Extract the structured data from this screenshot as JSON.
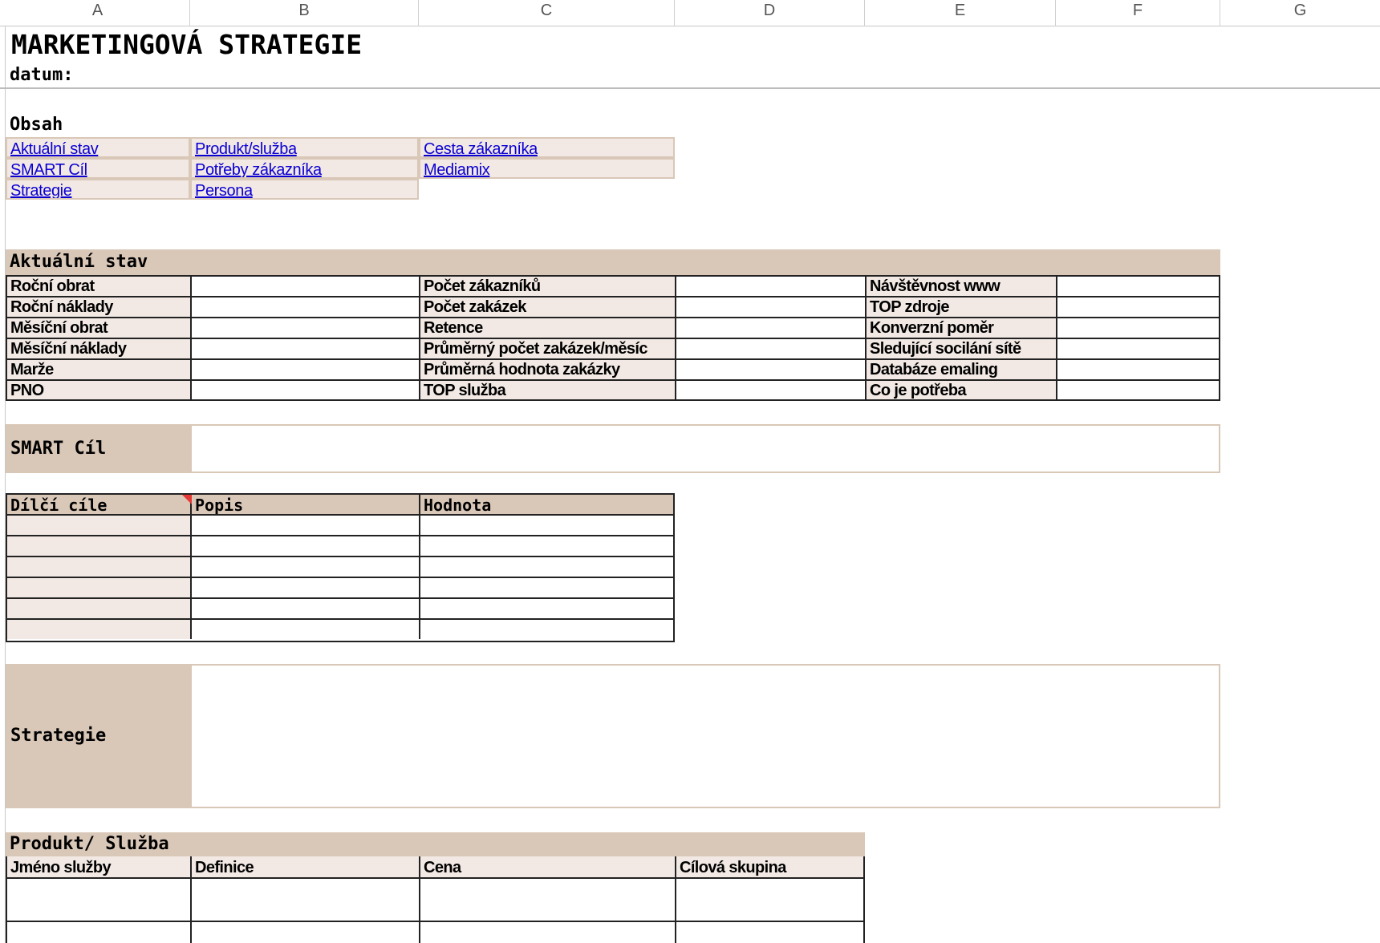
{
  "columns": [
    "A",
    "B",
    "C",
    "D",
    "E",
    "F",
    "G"
  ],
  "title": "MARKETINGOVÁ STRATEGIE",
  "date_label": "datum:",
  "toc": {
    "heading": "Obsah",
    "links": [
      "Aktuální stav",
      "Produkt/služba",
      "Cesta zákazníka",
      "SMART Cíl",
      "Potřeby zákazníka",
      "Mediamix",
      "Strategie",
      "Persona"
    ]
  },
  "current_state": {
    "heading": "Aktuální stav",
    "col1": [
      "Roční obrat",
      "Roční náklady",
      "Měsíční obrat",
      "Měsíční náklady",
      "Marže",
      "PNO"
    ],
    "col2": [
      "Počet zákazníků",
      "Počet zakázek",
      "Retence",
      "Průměrný počet zakázek/měsíc",
      "Průměrná hodnota zakázky",
      "TOP služba"
    ],
    "col3": [
      "Návštěvnost www",
      "TOP zdroje",
      "Konverzní poměr",
      "Sledující socilání sítě",
      "Databáze emaling",
      "Co je potřeba"
    ]
  },
  "smart_goal": {
    "label": "SMART Cíl"
  },
  "subgoals": {
    "headers": [
      "Dílčí cíle",
      "Popis",
      "Hodnota"
    ],
    "rows": 6
  },
  "strategy": {
    "label": "Strategie"
  },
  "product": {
    "heading": "Produkt/ Služba",
    "headers": [
      "Jméno služby",
      "Definice",
      "Cena",
      "Cílová skupina"
    ]
  }
}
